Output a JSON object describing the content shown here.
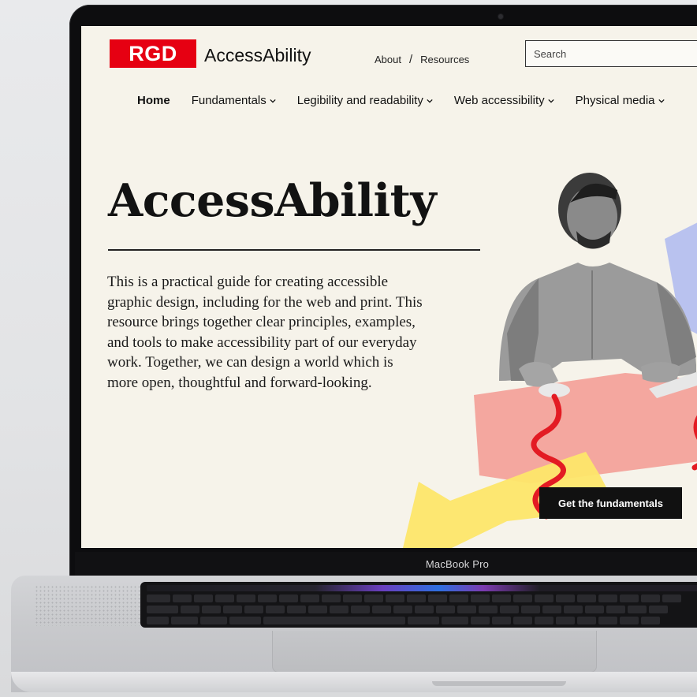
{
  "site": {
    "logo_mark": "RGD",
    "logo_text": "AccessAbility",
    "brand_color": "#e60012"
  },
  "top_nav": {
    "about": "About",
    "separator": "/",
    "resources": "Resources"
  },
  "search": {
    "placeholder": "Search"
  },
  "main_nav": {
    "items": [
      {
        "label": "Home",
        "active": true
      },
      {
        "label": "Fundamentals",
        "icon": "chevron-down-icon"
      },
      {
        "label": "Legibility and readability",
        "icon": "chevron-down-icon"
      },
      {
        "label": "Web accessibility",
        "icon": "chevron-down-icon"
      },
      {
        "label": "Physical media",
        "icon": "chevron-down-icon"
      }
    ]
  },
  "hero": {
    "title": "AccessAbility",
    "intro": "This is a practical guide for creating accessible graphic design, including for the web and print. This resource brings together clear principles, examples, and tools to make accessibility part of our everyday work. Together, we can design a world which is more open, thoughtful and forward-looking.",
    "cta_label": "Get the fundamentals"
  },
  "device": {
    "model_label": "MacBook Pro"
  },
  "colors": {
    "page_bg": "#f6f3ea",
    "shape_pink": "#f4a79f",
    "shape_yellow": "#fde66a",
    "shape_blue": "#b9c2ef",
    "squiggle_red": "#e31b23"
  }
}
